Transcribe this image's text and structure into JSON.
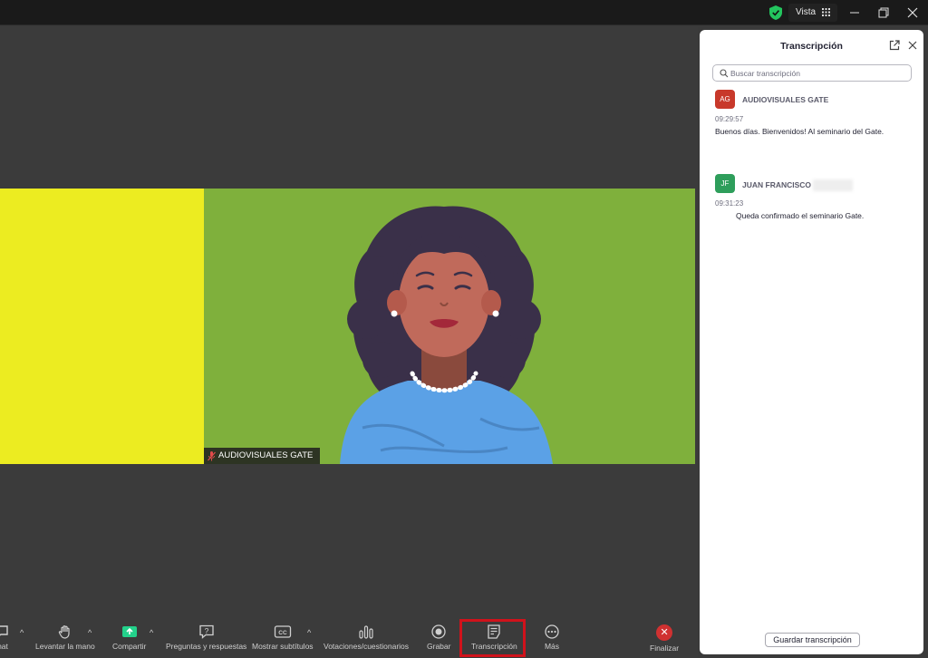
{
  "titlebar": {
    "view_label": "Vista",
    "accent_color": "#23c55e"
  },
  "meeting": {
    "participant_name": "AUDIOVISUALES GATE"
  },
  "toolbar": {
    "chat": "hat",
    "raise_hand": "Levantar la mano",
    "share": "Compartir",
    "qa": "Preguntas y respuestas",
    "captions": "Mostrar subtítulos",
    "polls": "Votaciones/cuestionarios",
    "record": "Grabar",
    "transcript": "Transcripción",
    "more": "Más",
    "end": "Finalizar",
    "share_color": "#23d18b",
    "end_color": "#d03131",
    "highlight_color": "#d0121b"
  },
  "transcript_panel": {
    "title": "Transcripción",
    "search_placeholder": "Buscar transcripción",
    "entries": [
      {
        "initials": "AG",
        "speaker": "AUDIOVISUALES GATE",
        "time": "09:29:57",
        "text": "Buenos días. Bienvenidos! Al seminario del  Gate.",
        "badge_color": "#c8392b"
      },
      {
        "initials": "JF",
        "speaker": "JUAN FRANCISCO",
        "time": "09:31:23",
        "text": "Queda confirmado el seminario  Gate.",
        "badge_color": "#2e9e5b"
      }
    ],
    "save_label": "Guardar transcripción"
  }
}
